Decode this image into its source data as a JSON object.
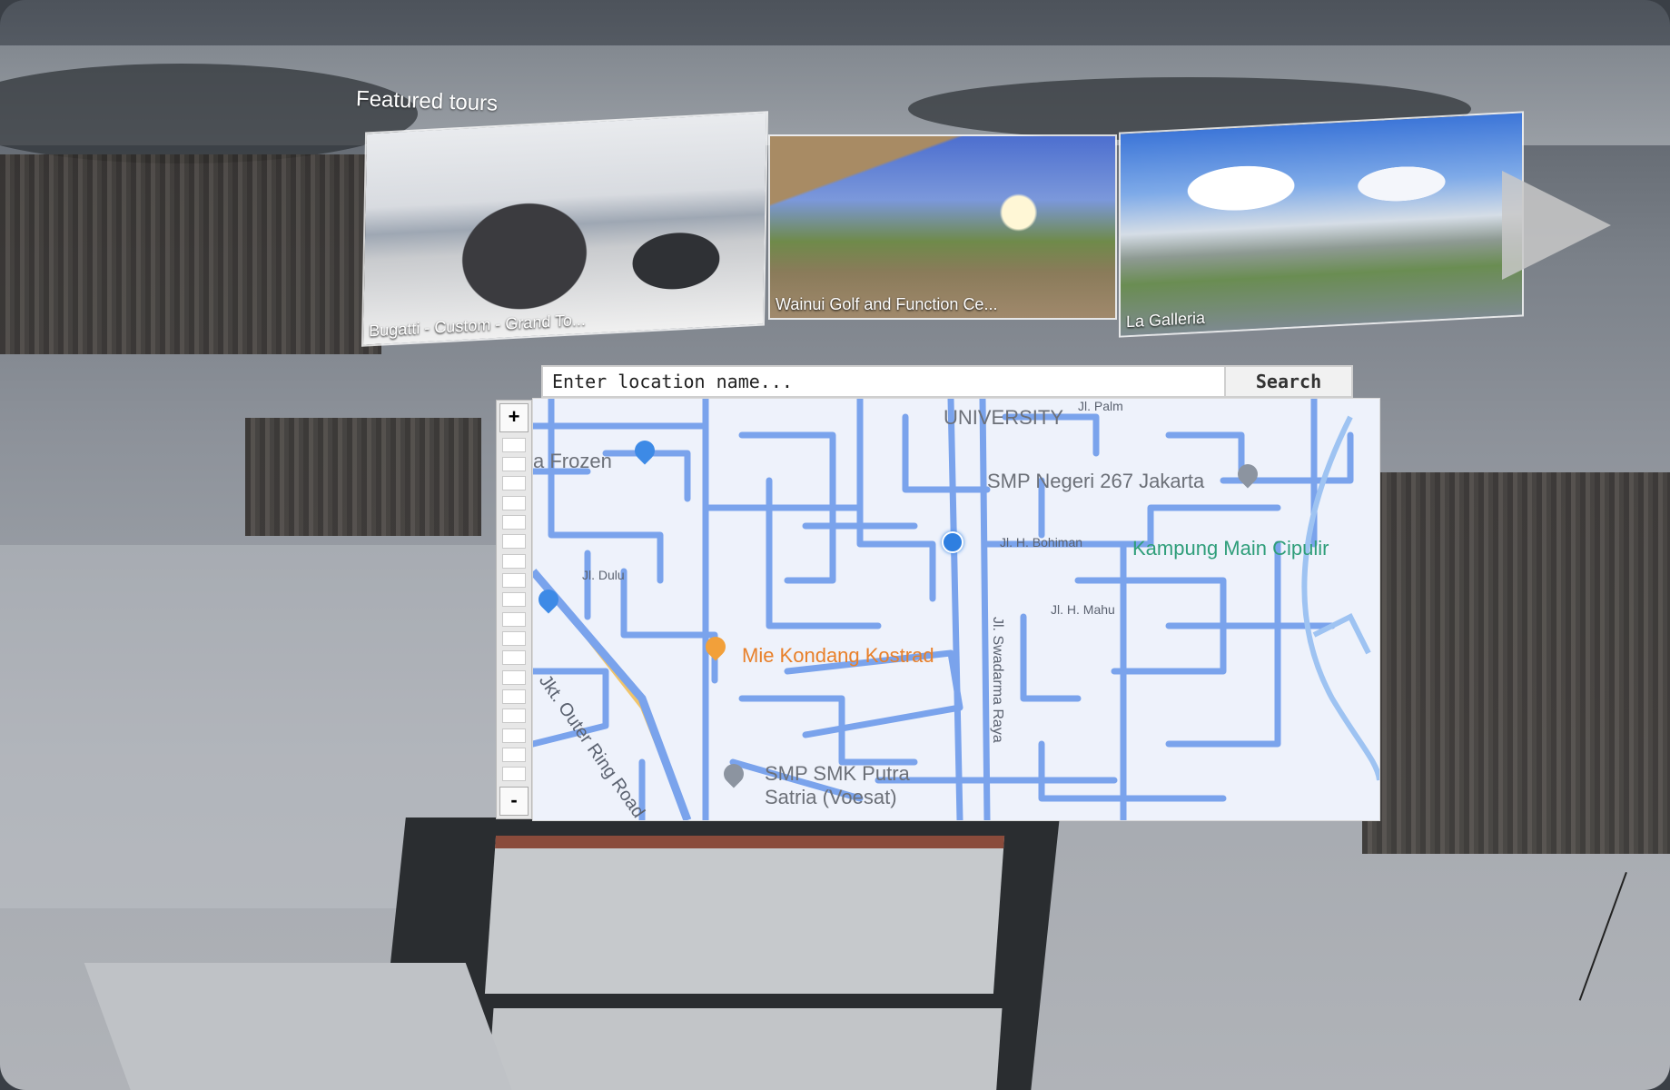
{
  "featured": {
    "title": "Featured tours",
    "tours": [
      {
        "label": "Bugatti - Custom - Grand To..."
      },
      {
        "label": "Wainui Golf and Function Ce..."
      },
      {
        "label": "La Galleria"
      }
    ]
  },
  "search": {
    "placeholder": "Enter location name...",
    "button_label": "Search"
  },
  "map": {
    "zoom_in": "+",
    "zoom_out": "-",
    "labels": {
      "university": "UNIVERSITY",
      "frozen": "a Frozen",
      "smp": "SMP Negeri 267 Jakarta",
      "kampung": "Kampung Main Cipulir",
      "mie": "Mie Kondang Kostrad",
      "smk": "SMP SMK Putra",
      "smk2": "Satria (Voesat)",
      "outer_ring": "Jkt. Outer Ring Road",
      "swadarma": "Jl. Swadarma Raya",
      "bohiman": "Jl. H. Bohiman",
      "dulu": "Jl. Dulu",
      "mahu": "Jl. H. Mahu",
      "palm": "Jl. Palm"
    }
  },
  "colors": {
    "road": "#7aa3ec",
    "map_bg": "#eef2fb",
    "accent_green": "#2f9e7a",
    "accent_orange": "#e8802a"
  }
}
